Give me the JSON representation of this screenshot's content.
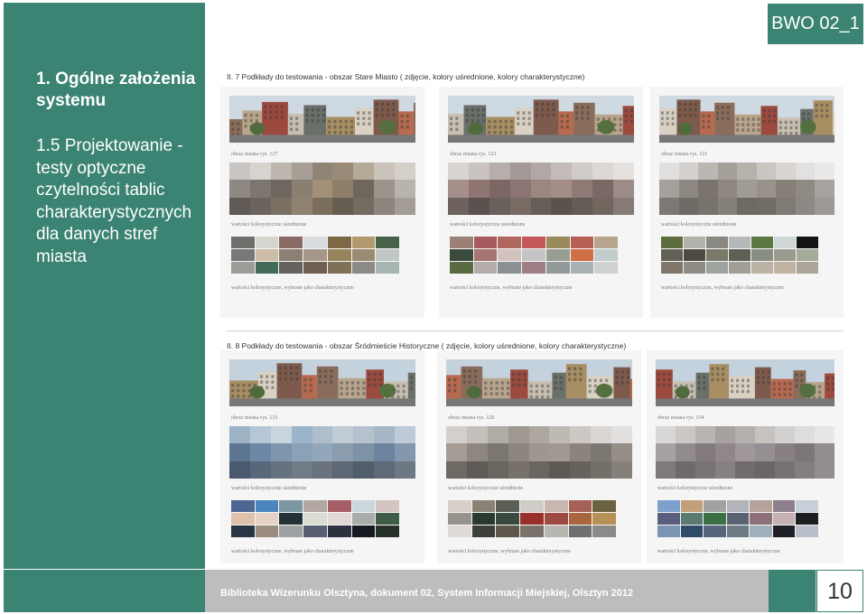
{
  "badge": "BWO 02_1",
  "sidebar": {
    "title": "1. Ogólne założenia systemu",
    "subtitle": "1.5 Projektowanie - testy optyczne czytelności tablic charakterystycznych dla danych stref miasta"
  },
  "section1": {
    "heading": "II. 7 Podkłady do testowania - obszar Stare Miasto ( zdjęcie, kolory uśrednione, kolory charakterystyczne)",
    "panels": [
      {
        "photo_caption": "obraz miasta rys. 127",
        "avg_caption": "wartości kolorystyczne uśrednione",
        "char_caption": "wartości kolorystyczne, wybrane jako charakterystyczne",
        "mosaic": [
          "#c9c5c3",
          "#d7d3cf",
          "#bdb7b0",
          "#a79f96",
          "#8f8476",
          "#9a8b78",
          "#b5aa98",
          "#c8c2b8",
          "#d3cfc9",
          "#8d8882",
          "#7c766f",
          "#6d6760",
          "#8a7f70",
          "#a29078",
          "#8f7e6a",
          "#6f665c",
          "#9b948b",
          "#b8b3ad",
          "#5f5a55",
          "#6b645c",
          "#7a7064",
          "#8f8270",
          "#7c6e5d",
          "#665d53",
          "#746b61",
          "#8c857d",
          "#a39d96"
        ],
        "swatches": [
          "#6d6f6b",
          "#d7d5cf",
          "#8a6a65",
          "#d9dcdf",
          "#7d6845",
          "#b29a6e",
          "#49634a",
          "#77787a",
          "#cdbda7",
          "#8c7f73",
          "#a7978a",
          "#96845c",
          "#9a8c72",
          "#c1c7c6",
          "#9e9c98",
          "#436a59",
          "#65615c",
          "#6d5f52",
          "#7e7156",
          "#8c8a85",
          "#a8b6b3"
        ]
      },
      {
        "photo_caption": "obraz miasta rys. 123",
        "avg_caption": "wartości kolorystyczne uśrednione",
        "char_caption": "wartości kolorystyczne, wybrane jako charakterystyczne",
        "mosaic": [
          "#d8d4d2",
          "#c9c3c1",
          "#b6aeab",
          "#a39a98",
          "#b1a7a4",
          "#c2bbb9",
          "#d0cbc8",
          "#dcd8d6",
          "#e4e1df",
          "#a58f8b",
          "#8f7571",
          "#7d6765",
          "#8b7471",
          "#9d8682",
          "#a48d87",
          "#8f7a75",
          "#7a6864",
          "#9c8b86",
          "#6d625e",
          "#5b524f",
          "#6a605b",
          "#776b64",
          "#685e58",
          "#5a524d",
          "#645b56",
          "#71675f",
          "#857b74"
        ],
        "swatches": [
          "#9a8076",
          "#a85b5e",
          "#b0675d",
          "#c2585a",
          "#988a5a",
          "#b75e55",
          "#b8a58e",
          "#3a4b3c",
          "#a67472",
          "#d2c3bc",
          "#c2c4c5",
          "#999e92",
          "#d06f45",
          "#c1cccc",
          "#5a6a42",
          "#b3acab",
          "#8a8f94",
          "#9f7e86",
          "#929a9a",
          "#a8b2b2",
          "#cfd2cf"
        ]
      },
      {
        "photo_caption": "obraz miasta rys. 121",
        "avg_caption": "wartości kolorystyczne uśrednione",
        "char_caption": "wartości kolorystyczne, wybrane jako charakterystyczne",
        "mosaic": [
          "#e0dfdd",
          "#d3d0cd",
          "#bbb7b3",
          "#a59f99",
          "#b6b1ab",
          "#cac6c2",
          "#d8d5d2",
          "#e3e1df",
          "#ebe9e8",
          "#a5a09c",
          "#8d8782",
          "#7b746e",
          "#8e8781",
          "#a19b95",
          "#999289",
          "#857f78",
          "#908a84",
          "#a8a39e",
          "#7d7873",
          "#6f6a65",
          "#77726c",
          "#85807a",
          "#6e6963",
          "#716b65",
          "#7f7a74",
          "#8d8883",
          "#9d9893"
        ],
        "swatches": [
          "#5d6d3e",
          "#b2b0aa",
          "#8a8882",
          "#b5b9ba",
          "#5b7842",
          "#cfd8d7",
          "#121413",
          "#625f56",
          "#4c4a43",
          "#7a7867",
          "#5e6054",
          "#8a8d84",
          "#9a9c90",
          "#a3ab99",
          "#81766a",
          "#8f8b84",
          "#9fa39d",
          "#a29e96",
          "#bab3a5",
          "#beb4a1",
          "#aba59a"
        ]
      }
    ]
  },
  "section2": {
    "heading": "II. 8 Podkłady do testowania - obszar Śródmieście Historyczne  ( zdjęcie, kolory uśrednione, kolory charakterystyczne)",
    "panels": [
      {
        "photo_caption": "obraz miasta rys. 133",
        "avg_caption": "wartości kolorystyczne uśrednione",
        "char_caption": "wartości kolorystyczne, wybrane jako charakterystyczne",
        "mosaic": [
          "#9fb3c6",
          "#b5c7d6",
          "#c8d5df",
          "#9cb4c9",
          "#aebecd",
          "#c0ccd6",
          "#b5c2cd",
          "#a7b7c7",
          "#bccbd7",
          "#5d7793",
          "#6b88a6",
          "#7d95ad",
          "#8aa1b7",
          "#93a7ba",
          "#8b9cae",
          "#7e92a6",
          "#6d84a0",
          "#8398ae",
          "#4a5a6e",
          "#586779",
          "#66727f",
          "#717b86",
          "#6a737d",
          "#5e6774",
          "#525d6b",
          "#606a77",
          "#6e7884"
        ],
        "swatches": [
          "#4d6694",
          "#4a86bd",
          "#7c96a3",
          "#b3a7a4",
          "#a85e66",
          "#cad7db",
          "#d4c4c2",
          "#e0c2ac",
          "#e5d1c6",
          "#243238",
          "#d9ddd2",
          "#e3d8d8",
          "#a9aeab",
          "#3e5c46",
          "#293542",
          "#9a8d80",
          "#9ca1a1",
          "#575d72",
          "#2d3240",
          "#161a20",
          "#263129"
        ]
      },
      {
        "photo_caption": "obraz miasta rys. 126",
        "avg_caption": "wartości kolorystyczne uśrednione",
        "char_caption": "wartości kolorystyczne, wybrane jako charakterystyczne",
        "mosaic": [
          "#d2cfcc",
          "#c3bfbb",
          "#b1aba5",
          "#9f9891",
          "#aea7a0",
          "#bfb9b4",
          "#cdc8c4",
          "#d9d6d3",
          "#e2e0de",
          "#a59c96",
          "#8e8680",
          "#7c7670",
          "#8c8580",
          "#9e9790",
          "#a19893",
          "#8a837e",
          "#7d7772",
          "#948d88",
          "#6f6964",
          "#5f5a56",
          "#6a655f",
          "#77716a",
          "#6b655f",
          "#5e5954",
          "#68625d",
          "#756f69",
          "#86807a"
        ],
        "swatches": [
          "#d6d0c9",
          "#8b8275",
          "#5b5e55",
          "#d0cdc8",
          "#c6b6ad",
          "#a66058",
          "#6a6240",
          "#96928c",
          "#2b3a2f",
          "#3b4a3f",
          "#9a2e2b",
          "#9d4a45",
          "#a8663f",
          "#b69157",
          "#e0dbd7",
          "#3d4038",
          "#5d574c",
          "#79716a",
          "#b7b6b0",
          "#6d6f70",
          "#8a8a88"
        ]
      },
      {
        "photo_caption": "obraz miasta rys. 134",
        "avg_caption": "wartości kolorystyczne uśrednione",
        "char_caption": "wartości kolorystyczne, wybrane jako charakterystyczne",
        "mosaic": [
          "#d9d7d6",
          "#cac7c5",
          "#b8b4b1",
          "#a7a29f",
          "#b4b0ad",
          "#c5c2bf",
          "#d3d1cf",
          "#dfdddc",
          "#e8e7e6",
          "#a6a1a2",
          "#928b8d",
          "#827a7c",
          "#8f8789",
          "#9f979a",
          "#958e92",
          "#877f84",
          "#7c767a",
          "#928d91",
          "#7e7a79",
          "#6e6a6a",
          "#797474",
          "#868080",
          "#706b6c",
          "#6a6567",
          "#767173",
          "#827e80",
          "#928e90"
        ],
        "swatches": [
          "#7da0cc",
          "#c4a07a",
          "#a4a2a0",
          "#b2b4ba",
          "#b6a19b",
          "#8e7f8c",
          "#c7cfd8",
          "#5b5f7d",
          "#5a7b72",
          "#3b7044",
          "#5a6272",
          "#8c6f78",
          "#c6b2b4",
          "#1c1e22",
          "#7c94b3",
          "#2e4b67",
          "#58637c",
          "#6c7a84",
          "#9fb0bc",
          "#1f1f26",
          "#b7bec8"
        ]
      }
    ]
  },
  "footer": {
    "text": "Biblioteka Wizerunku Olsztyna, dokument 02, System Informacji Miejskiej, Olsztyn 2012",
    "page_number": "10"
  }
}
